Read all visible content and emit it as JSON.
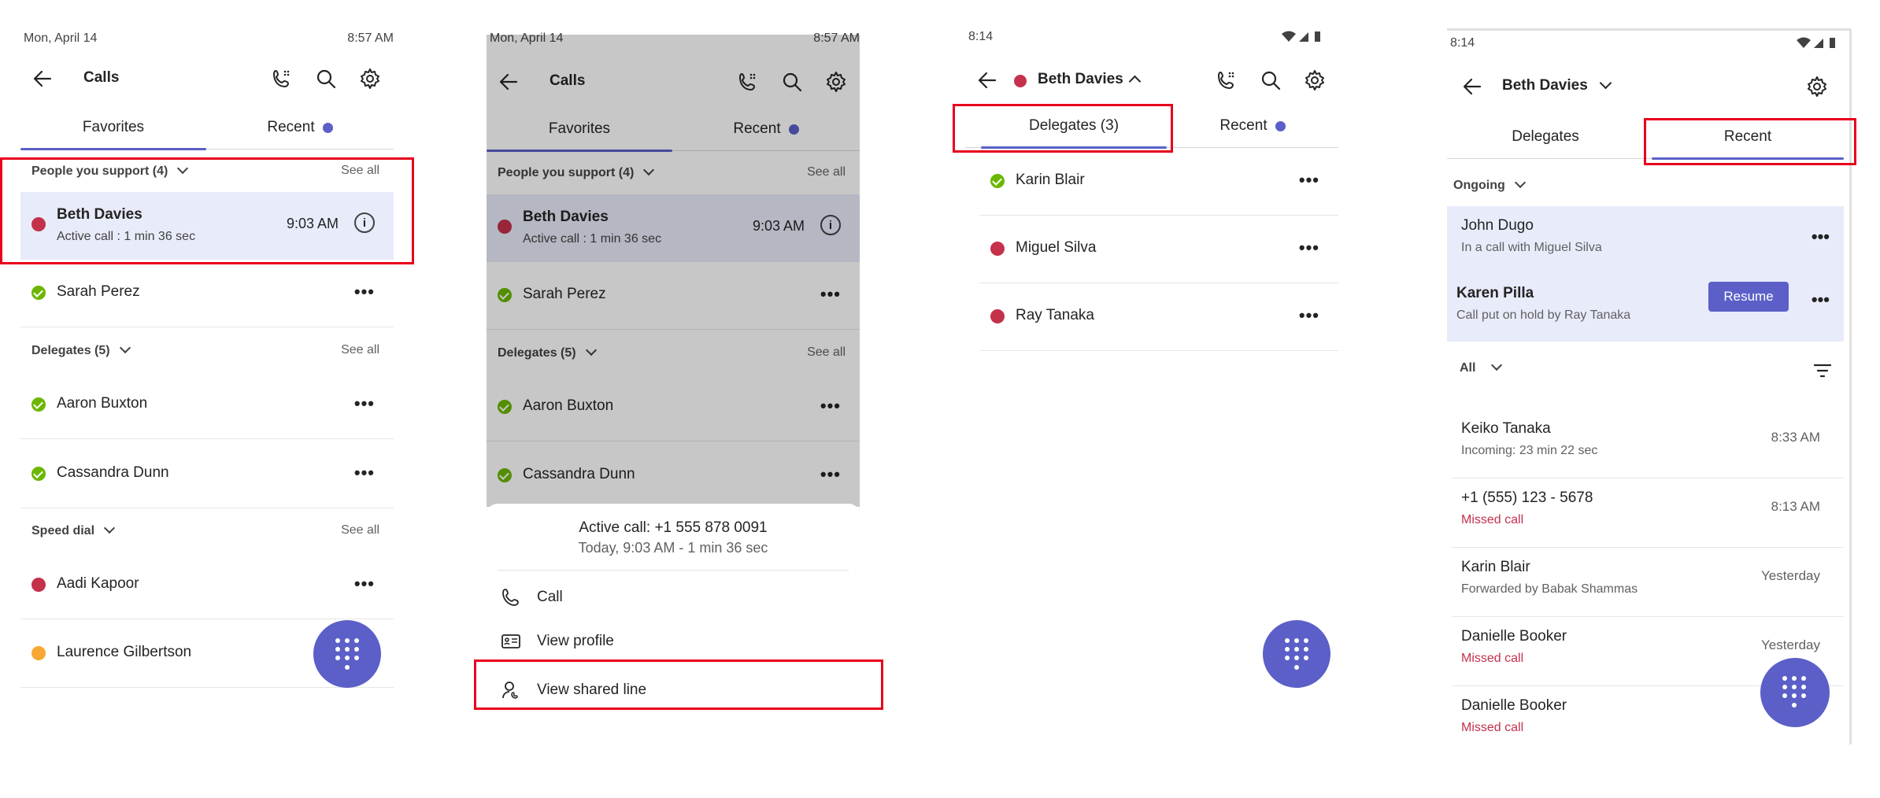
{
  "screen1": {
    "status": {
      "date": "Mon, April 14",
      "time": "8:57 AM"
    },
    "title": "Calls",
    "tabs": {
      "favorites": "Favorites",
      "recent": "Recent"
    },
    "people_section": {
      "label": "People you support (4)",
      "see_all": "See all"
    },
    "active": {
      "name": "Beth Davies",
      "status": "Active call : 1 min 36 sec",
      "time": "9:03 AM"
    },
    "sarah": "Sarah Perez",
    "delegates_section": {
      "label": "Delegates (5)",
      "see_all": "See all"
    },
    "delegates": [
      "Aaron Buxton",
      "Cassandra Dunn"
    ],
    "speed_section": {
      "label": "Speed dial",
      "see_all": "See all"
    },
    "speed": [
      "Aadi Kapoor",
      "Laurence Gilbertson"
    ]
  },
  "screen2": {
    "status": {
      "date": "Mon, April 14",
      "time": "8:57 AM"
    },
    "title": "Calls",
    "tabs": {
      "favorites": "Favorites",
      "recent": "Recent"
    },
    "people_section": {
      "label": "People you support (4)",
      "see_all": "See all"
    },
    "active": {
      "name": "Beth Davies",
      "status": "Active call : 1 min 36 sec",
      "time": "9:03 AM"
    },
    "sarah": "Sarah Perez",
    "delegates_section": {
      "label": "Delegates (5)",
      "see_all": "See all"
    },
    "delegates": [
      "Aaron Buxton",
      "Cassandra Dunn"
    ],
    "sheet": {
      "title": "Active call: +1 555 878 0091",
      "subtitle": "Today, 9:03 AM - 1 min 36 sec",
      "actions": [
        "Call",
        "View profile",
        "View shared line"
      ]
    }
  },
  "screen3": {
    "status": {
      "time": "8:14"
    },
    "title": "Beth Davies",
    "tabs": {
      "delegates": "Delegates (3)",
      "recent": "Recent"
    },
    "people": [
      "Karin Blair",
      "Miguel Silva",
      "Ray Tanaka"
    ]
  },
  "screen4": {
    "status": {
      "time": "8:14"
    },
    "title": "Beth Davies",
    "tabs": {
      "delegates": "Delegates",
      "recent": "Recent"
    },
    "ongoing_label": "Ongoing",
    "ongoing": [
      {
        "name": "John Dugo",
        "status": "In a call with Miguel Silva"
      },
      {
        "name": "Karen Pilla",
        "status": "Call put on hold by Ray Tanaka",
        "action": "Resume"
      }
    ],
    "filter_label": "All",
    "calls": [
      {
        "name": "Keiko Tanaka",
        "status": "Incoming: 23 min 22 sec",
        "time": "8:33 AM"
      },
      {
        "name": "+1 (555) 123 - 5678",
        "status": "Missed call",
        "time": "8:13 AM"
      },
      {
        "name": "Karin Blair",
        "status": "Forwarded by Babak Shammas",
        "time": "Yesterday"
      },
      {
        "name": "Danielle Booker",
        "status": "Missed call",
        "time": "Yesterday"
      },
      {
        "name": "Danielle Booker",
        "status": "Missed call",
        "time": ""
      }
    ]
  },
  "colors": {
    "accent": "#5b5fc7",
    "highlight": "#e8ebfa",
    "busy": "#c4314b",
    "available": "#6bb700",
    "away": "#f8a733",
    "callout": "#e8001c"
  }
}
